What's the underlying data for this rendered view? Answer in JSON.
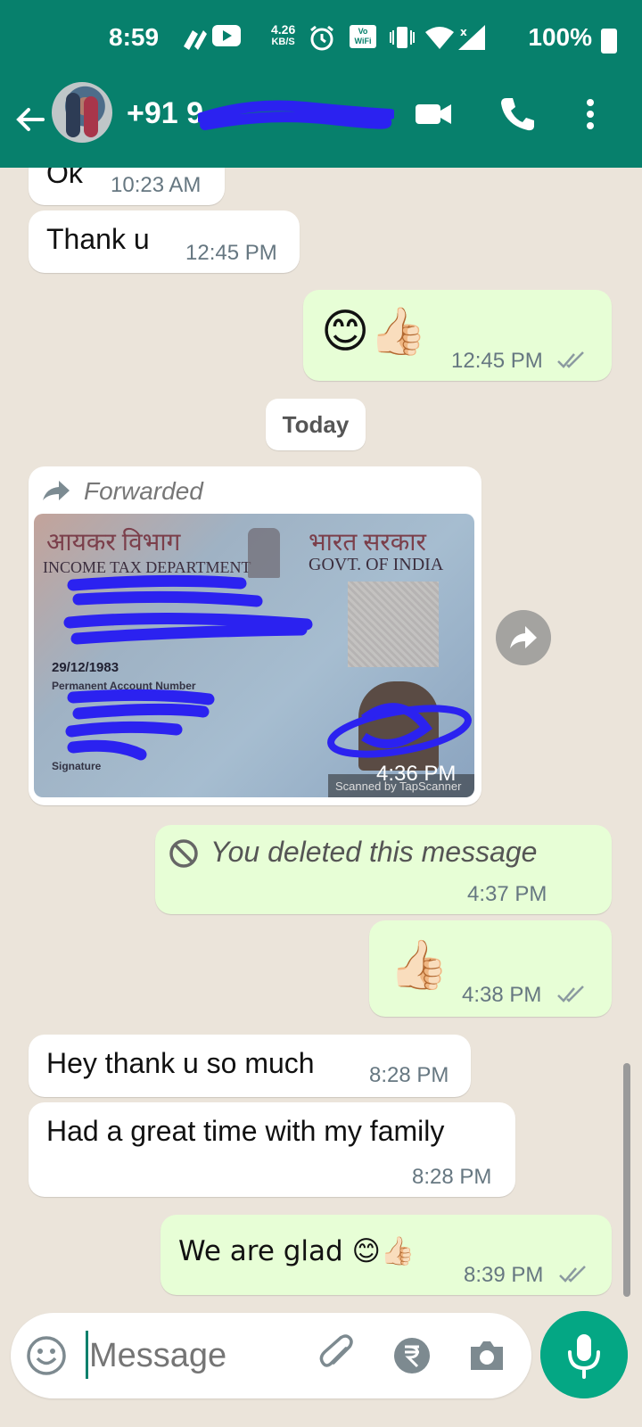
{
  "status_bar": {
    "time": "8:59",
    "net_speed_value": "4.26",
    "net_speed_unit": "KB/S",
    "battery": "100%",
    "vowifi_label": "Vo WiFi"
  },
  "header": {
    "contact_visible": "+91 9",
    "back_icon": "arrow-left-icon",
    "video_icon": "video-camera-icon",
    "call_icon": "phone-icon",
    "menu_icon": "more-vert-icon"
  },
  "messages": [
    {
      "dir": "in",
      "text": "Ok",
      "time": "10:23 AM"
    },
    {
      "dir": "in",
      "text": "Thank u",
      "time": "12:45 PM"
    },
    {
      "dir": "out",
      "text": "😊👍🏻",
      "time": "12:45 PM"
    },
    {
      "dir": "date",
      "text": "Today"
    },
    {
      "dir": "in",
      "type": "image",
      "forwarded_label": "Forwarded",
      "time": "4:36 PM",
      "image_text": {
        "hindi_left": "आयकर विभाग",
        "dept": "INCOME TAX DEPARTMENT",
        "hindi_right": "भारत सरकार",
        "govt": "GOVT. OF INDIA",
        "dob": "29/12/1983",
        "pan_label": "Permanent Account Number",
        "signature_label": "Signature",
        "scanner": "Scanned by TapScanner"
      }
    },
    {
      "dir": "out",
      "type": "deleted",
      "text": "You deleted this message",
      "time": "4:37 PM"
    },
    {
      "dir": "out",
      "text": "👍🏻",
      "time": "4:38 PM"
    },
    {
      "dir": "in",
      "text": "Hey thank u so much",
      "time": "8:28 PM"
    },
    {
      "dir": "in",
      "text": "Had a great time with my family",
      "time": "8:28 PM"
    },
    {
      "dir": "out",
      "text": "We are glad 😊👍🏻",
      "time": "8:39 PM"
    }
  ],
  "input": {
    "placeholder": "Message",
    "icons": [
      "emoji-icon",
      "attach-icon",
      "rupee-icon",
      "camera-icon",
      "mic-icon"
    ]
  },
  "colors": {
    "header": "#07806c",
    "outgoing_bubble": "#e7fed6",
    "incoming_bubble": "#ffffff",
    "mic_button": "#04a784",
    "chat_bg": "#ece5dd",
    "redaction": "#2b22f0"
  }
}
